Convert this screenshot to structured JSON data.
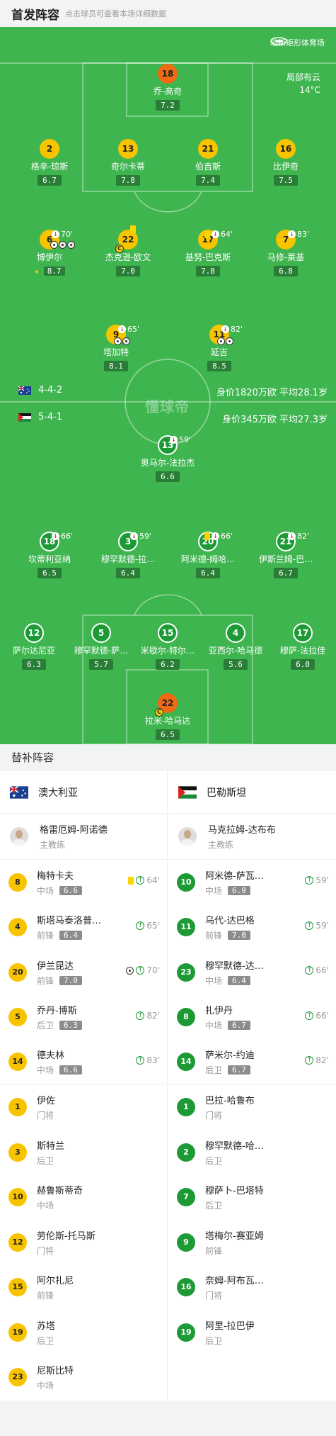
{
  "header": {
    "title": "首发阵容",
    "subtitle": "点击球员可查看本场详细数据"
  },
  "pitch": {
    "venue": "珀斯矩形体育场",
    "weather": "局部有云",
    "temp": "14°C",
    "watermark": "懂球帝"
  },
  "home": {
    "team": "澳大利亚",
    "formation": "4-4-2",
    "value": "身价1820万欧  平均28.1岁",
    "coach": "格雷厄姆-阿诺德",
    "coach_role": "主教练",
    "starters": [
      {
        "num": "18",
        "name": "乔-高奇",
        "rating": "7.2"
      },
      {
        "num": "2",
        "name": "格辛-琼斯",
        "rating": "6.7"
      },
      {
        "num": "13",
        "name": "奇尔卡蒂",
        "rating": "7.8"
      },
      {
        "num": "21",
        "name": "伯吉斯",
        "rating": "7.4"
      },
      {
        "num": "16",
        "name": "比伊奇",
        "rating": "7.5"
      },
      {
        "num": "6",
        "name": "博伊尔",
        "rating": "8.7",
        "min": "70'"
      },
      {
        "num": "22",
        "name": "杰克逊-欧文",
        "rating": "7.0",
        "cap": "C"
      },
      {
        "num": "17",
        "name": "基努-巴克斯",
        "rating": "7.8",
        "min": "64'"
      },
      {
        "num": "7",
        "name": "马修-莱基",
        "rating": "6.8",
        "min": "83'"
      },
      {
        "num": "9",
        "name": "塔加特",
        "rating": "8.1",
        "min": "65'"
      },
      {
        "num": "11",
        "name": "延吉",
        "rating": "8.5",
        "min": "82'"
      }
    ]
  },
  "away": {
    "team": "巴勒斯坦",
    "formation": "5-4-1",
    "value": "身价345万欧  平均27.3岁",
    "coach": "马克拉姆-达布布",
    "coach_role": "主教练",
    "starters": [
      {
        "num": "13",
        "name": "奥马尔-法拉杰",
        "rating": "6.6",
        "min": "59'"
      },
      {
        "num": "18",
        "name": "坎蒂利亚纳",
        "rating": "6.5",
        "min": "66'"
      },
      {
        "num": "3",
        "name": "穆罕默德-拉…",
        "rating": "6.4",
        "min": "59'"
      },
      {
        "num": "20",
        "name": "阿米德-姆哈…",
        "rating": "6.4",
        "min": "66'"
      },
      {
        "num": "21",
        "name": "伊斯兰姆-巴…",
        "rating": "6.7",
        "min": "82'"
      },
      {
        "num": "12",
        "name": "萨尔达尼亚",
        "rating": "6.3"
      },
      {
        "num": "5",
        "name": "穆罕默德-萨…",
        "rating": "5.7"
      },
      {
        "num": "15",
        "name": "米歇尔-特尔…",
        "rating": "6.2"
      },
      {
        "num": "4",
        "name": "亚西尔-哈马德",
        "rating": "5.6"
      },
      {
        "num": "17",
        "name": "穆萨-法拉佳",
        "rating": "6.0"
      },
      {
        "num": "22",
        "name": "拉米-哈马达",
        "rating": "6.5",
        "cap": "C"
      }
    ]
  },
  "subs_title": "替补阵容",
  "home_subs": [
    {
      "num": "8",
      "name": "梅特卡夫",
      "pos": "中场",
      "rating": "6.6",
      "min": "64'"
    },
    {
      "num": "4",
      "name": "斯塔马泰洛普…",
      "pos": "前锋",
      "rating": "6.4",
      "min": "65'"
    },
    {
      "num": "20",
      "name": "伊兰昆达",
      "pos": "前锋",
      "rating": "7.0",
      "min": "70'"
    },
    {
      "num": "5",
      "name": "乔丹-博斯",
      "pos": "后卫",
      "rating": "6.3",
      "min": "82'"
    },
    {
      "num": "14",
      "name": "德夫林",
      "pos": "中场",
      "rating": "6.6",
      "min": "83'"
    },
    {
      "num": "1",
      "name": "伊佐",
      "pos": "门将"
    },
    {
      "num": "3",
      "name": "斯特兰",
      "pos": "后卫"
    },
    {
      "num": "10",
      "name": "赫鲁斯蒂奇",
      "pos": "中场"
    },
    {
      "num": "12",
      "name": "劳伦斯-托马斯",
      "pos": "门将"
    },
    {
      "num": "15",
      "name": "阿尔扎尼",
      "pos": "前锋"
    },
    {
      "num": "19",
      "name": "苏塔",
      "pos": "后卫"
    },
    {
      "num": "23",
      "name": "尼斯比特",
      "pos": "中场"
    }
  ],
  "away_subs": [
    {
      "num": "10",
      "name": "阿米德-萨瓦…",
      "pos": "中场",
      "rating": "6.9",
      "min": "59'"
    },
    {
      "num": "11",
      "name": "乌代-达巴格",
      "pos": "前锋",
      "rating": "7.0",
      "min": "59'"
    },
    {
      "num": "23",
      "name": "穆罕默德-达…",
      "pos": "中场",
      "rating": "6.4",
      "min": "66'"
    },
    {
      "num": "8",
      "name": "扎伊丹",
      "pos": "中场",
      "rating": "6.7",
      "min": "66'"
    },
    {
      "num": "14",
      "name": "萨米尔-约迪",
      "pos": "后卫",
      "rating": "6.7",
      "min": "82'"
    },
    {
      "num": "1",
      "name": "巴拉-哈鲁布",
      "pos": "门将"
    },
    {
      "num": "2",
      "name": "穆罕默德-哈…",
      "pos": "后卫"
    },
    {
      "num": "7",
      "name": "穆萨卜-巴塔特",
      "pos": "后卫"
    },
    {
      "num": "9",
      "name": "塔梅尔-赛亚姆",
      "pos": "前锋"
    },
    {
      "num": "16",
      "name": "奈姆-阿布瓦…",
      "pos": "门将"
    },
    {
      "num": "19",
      "name": "阿里-拉巴伊",
      "pos": "后卫"
    }
  ]
}
